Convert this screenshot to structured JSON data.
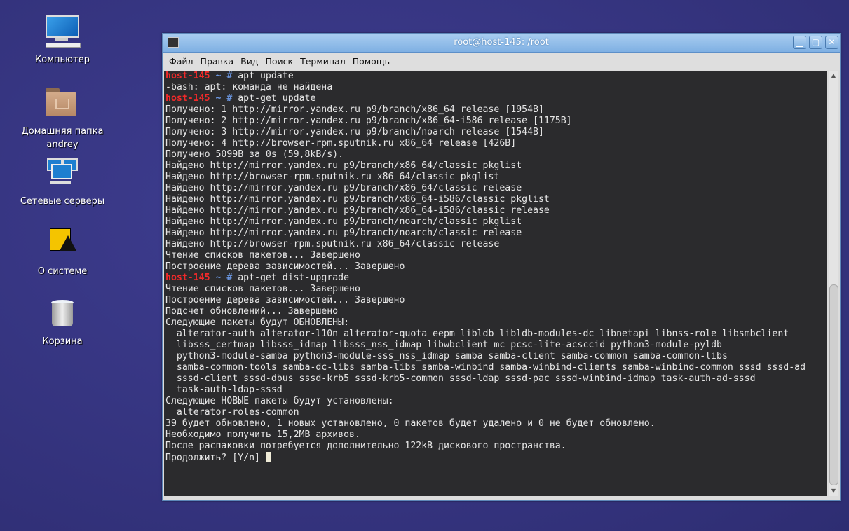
{
  "desktop": {
    "icons": [
      {
        "label": "Компьютер",
        "icon": "computer-icon"
      },
      {
        "label": "Домашняя папка andrey",
        "icon": "home-folder-icon"
      },
      {
        "label": "Сетевые серверы",
        "icon": "network-servers-icon"
      },
      {
        "label": "О системе",
        "icon": "basealt-logo-icon"
      },
      {
        "label": "Корзина",
        "icon": "trash-icon"
      }
    ]
  },
  "window": {
    "title": "root@host-145: /root",
    "menu": [
      "Файл",
      "Правка",
      "Вид",
      "Поиск",
      "Терминал",
      "Помощь"
    ],
    "buttons": {
      "minimize": "▁",
      "maximize": "▢",
      "close": "✕"
    }
  },
  "colors": {
    "prompt_host": "#f02a2a",
    "prompt_symbol": "#6b96e0",
    "text": "#e6e6e6",
    "background": "#2b2b2d"
  },
  "terminal": {
    "lines": [
      {
        "host": "host-145",
        "sym": " ~ # ",
        "cmd": "apt update"
      },
      {
        "text": "-bash: apt: команда не найдена"
      },
      {
        "host": "host-145",
        "sym": " ~ # ",
        "cmd": "apt-get update"
      },
      {
        "text": "Получено: 1 http://mirror.yandex.ru p9/branch/x86_64 release [1954B]"
      },
      {
        "text": "Получено: 2 http://mirror.yandex.ru p9/branch/x86_64-i586 release [1175B]"
      },
      {
        "text": "Получено: 3 http://mirror.yandex.ru p9/branch/noarch release [1544B]"
      },
      {
        "text": "Получено: 4 http://browser-rpm.sputnik.ru x86_64 release [426B]"
      },
      {
        "text": "Получено 5099B за 0s (59,8kB/s)."
      },
      {
        "text": "Найдено http://mirror.yandex.ru p9/branch/x86_64/classic pkglist"
      },
      {
        "text": "Найдено http://browser-rpm.sputnik.ru x86_64/classic pkglist"
      },
      {
        "text": "Найдено http://mirror.yandex.ru p9/branch/x86_64/classic release"
      },
      {
        "text": "Найдено http://mirror.yandex.ru p9/branch/x86_64-i586/classic pkglist"
      },
      {
        "text": "Найдено http://mirror.yandex.ru p9/branch/x86_64-i586/classic release"
      },
      {
        "text": "Найдено http://mirror.yandex.ru p9/branch/noarch/classic pkglist"
      },
      {
        "text": "Найдено http://mirror.yandex.ru p9/branch/noarch/classic release"
      },
      {
        "text": "Найдено http://browser-rpm.sputnik.ru x86_64/classic release"
      },
      {
        "text": "Чтение списков пакетов... Завершено"
      },
      {
        "text": "Построение дерева зависимостей... Завершено"
      },
      {
        "host": "host-145",
        "sym": " ~ # ",
        "cmd": "apt-get dist-upgrade"
      },
      {
        "text": "Чтение списков пакетов... Завершено"
      },
      {
        "text": "Построение дерева зависимостей... Завершено"
      },
      {
        "text": "Подсчет обновлений... Завершено"
      },
      {
        "text": "Следующие пакеты будут ОБНОВЛЕНЫ:"
      },
      {
        "text": "  alterator-auth alterator-l10n alterator-quota eepm libldb libldb-modules-dc libnetapi libnss-role libsmbclient"
      },
      {
        "text": "  libsss_certmap libsss_idmap libsss_nss_idmap libwbclient mc pcsc-lite-acsccid python3-module-pyldb"
      },
      {
        "text": "  python3-module-samba python3-module-sss_nss_idmap samba samba-client samba-common samba-common-libs"
      },
      {
        "text": "  samba-common-tools samba-dc-libs samba-libs samba-winbind samba-winbind-clients samba-winbind-common sssd sssd-ad"
      },
      {
        "text": "  sssd-client sssd-dbus sssd-krb5 sssd-krb5-common sssd-ldap sssd-pac sssd-winbind-idmap task-auth-ad-sssd"
      },
      {
        "text": "  task-auth-ldap-sssd"
      },
      {
        "text": "Следующие НОВЫЕ пакеты будут установлены:"
      },
      {
        "text": "  alterator-roles-common"
      },
      {
        "text": "39 будет обновлено, 1 новых установлено, 0 пакетов будет удалено и 0 не будет обновлено."
      },
      {
        "text": "Необходимо получить 15,2MB архивов."
      },
      {
        "text": "После распаковки потребуется дополнительно 122kB дискового пространства."
      },
      {
        "text": "Продолжить? [Y/n] ",
        "cursor": true
      }
    ]
  }
}
